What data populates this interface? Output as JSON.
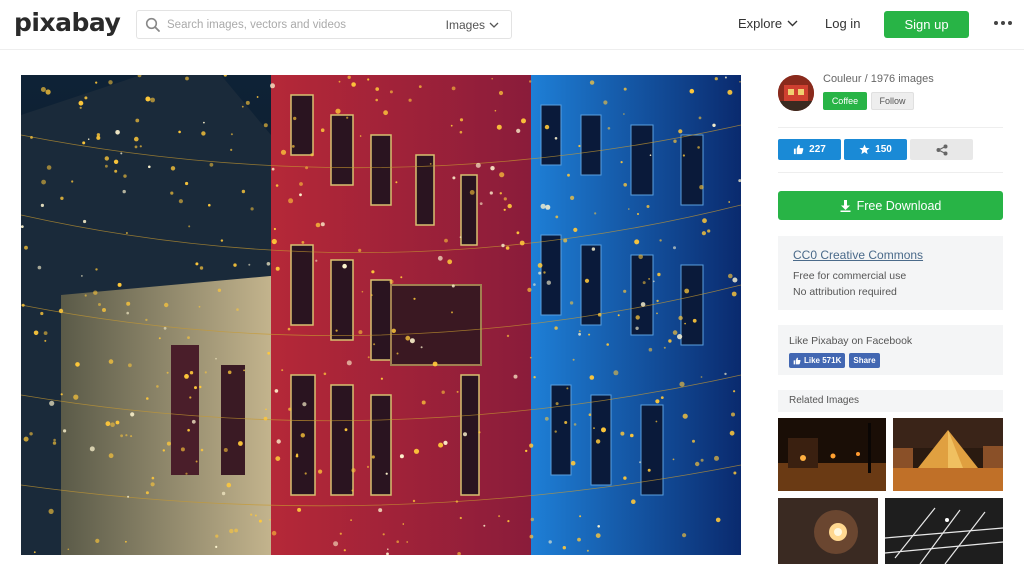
{
  "header": {
    "logo": "pixabay",
    "search_placeholder": "Search images, vectors and videos",
    "search_scope": "Images",
    "nav_explore": "Explore",
    "nav_login": "Log in",
    "signup": "Sign up"
  },
  "author": {
    "name": "Couleur",
    "separator": " / ",
    "image_count": "1976 images",
    "coffee_label": "Coffee",
    "follow_label": "Follow"
  },
  "stats": {
    "likes": "227",
    "favorites": "150"
  },
  "download": {
    "label": "Free Download"
  },
  "license": {
    "title": "CC0 Creative Commons",
    "line1": "Free for commercial use",
    "line2": "No attribution required"
  },
  "facebook": {
    "title": "Like Pixabay on Facebook",
    "like_label": "Like 571K",
    "share_label": "Share"
  },
  "related": {
    "title": "Related Images"
  },
  "colors": {
    "brand_green": "#28b446",
    "action_blue": "#1a8ad6",
    "facebook_blue": "#4267b2"
  },
  "icons": [
    "search-icon",
    "chevron-down-icon",
    "more-dots-icon",
    "thumbs-up-icon",
    "star-icon",
    "share-icon",
    "download-icon",
    "facebook-icon"
  ]
}
